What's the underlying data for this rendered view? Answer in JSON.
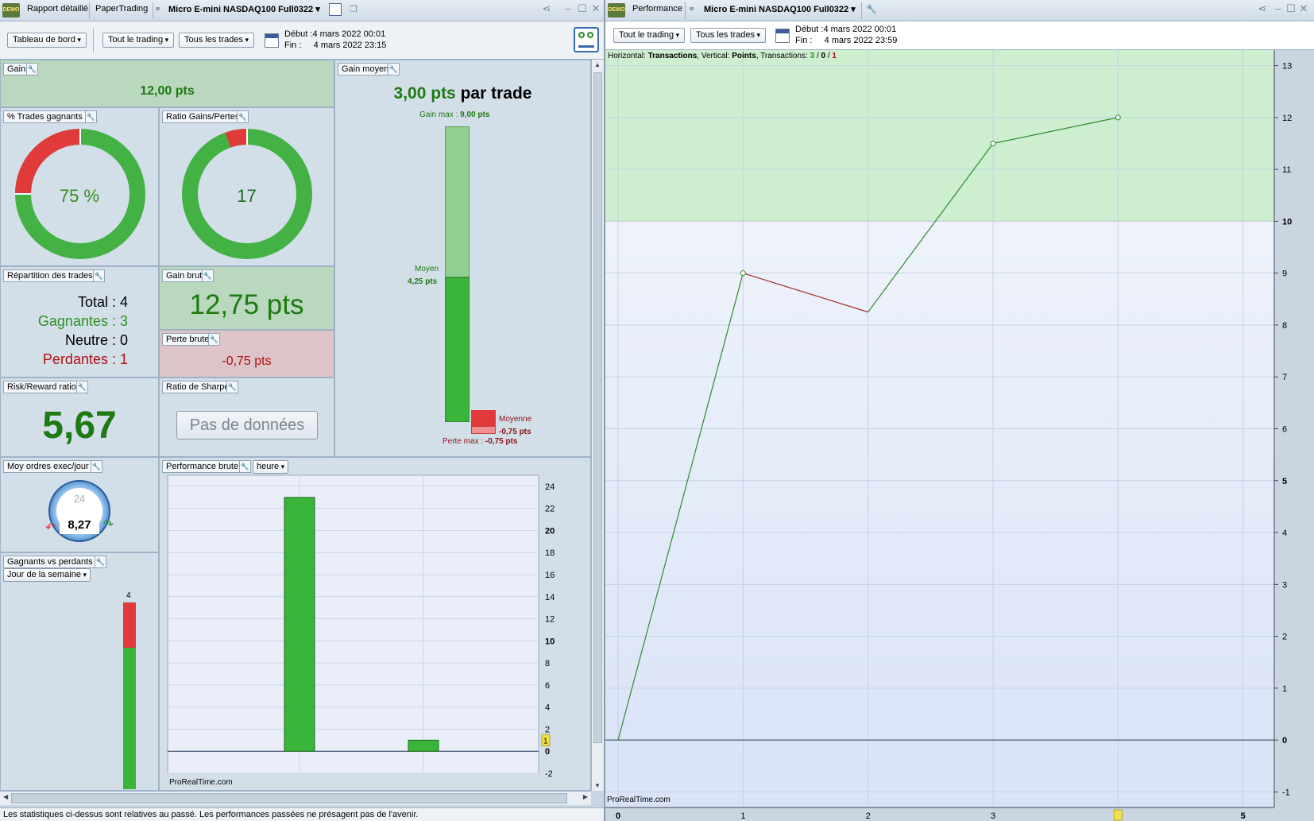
{
  "left_window": {
    "tabs": [
      "Rapport détaillé",
      "PaperTrading",
      "Micro E-mini NASDAQ100 Full0322"
    ],
    "demo_badge": "DEMO",
    "toolbar": {
      "dashboard": "Tableau de bord",
      "trading": "Tout le trading",
      "trades": "Tous les trades",
      "debut": "Début :4 mars 2022 00:01",
      "fin": "Fin :     4 mars 2022 23:15"
    }
  },
  "widgets": {
    "gain": {
      "title": "Gain",
      "value": "12,00 pts"
    },
    "pct_gagnants": {
      "title": "% Trades gagnants",
      "value": "75 %",
      "fraction": 0.75
    },
    "ratio_gp": {
      "title": "Ratio Gains/Pertes",
      "value": "17",
      "fraction": 0.944
    },
    "gain_moyen": {
      "title": "Gain moyen",
      "value": "3,00 pts",
      "suffix": "par trade",
      "gain_max_label": "Gain max :",
      "gain_max_value": "9,00 pts",
      "moyen_label": "Moyen",
      "moyen_value": "4,25 pts",
      "moyenne_label": "Moyenne",
      "moyenne_value": "-0,75 pts",
      "perte_max_label": "Perte max :",
      "perte_max_value": "-0,75 pts"
    },
    "repartition": {
      "title": "Répartition des trades",
      "total": "Total : 4",
      "gagnantes": "Gagnantes : 3",
      "neutre": "Neutre : 0",
      "perdantes": "Perdantes : 1"
    },
    "gain_brut": {
      "title": "Gain brut",
      "value": "12,75 pts"
    },
    "perte_brute": {
      "title": "Perte brute",
      "value": "-0,75 pts"
    },
    "risk_reward": {
      "title": "Risk/Reward ratio",
      "value": "5,67"
    },
    "sharpe": {
      "title": "Ratio de Sharpe",
      "value": "Pas de données"
    },
    "moy_ordres": {
      "title": "Moy ordres exec/jour",
      "value": "8,27",
      "dial_label": "24"
    },
    "gagnants_vs_perdants": {
      "title": "Gagnants vs perdants",
      "dropdown": "Jour de la semaine",
      "top_label": "4"
    },
    "perf_brute": {
      "title": "Performance brute",
      "dropdown": "heure",
      "watermark": "ProRealTime.com",
      "yticks": [
        "24",
        "22",
        "20",
        "18",
        "16",
        "14",
        "12",
        "10",
        "8",
        "6",
        "4",
        "2",
        "0",
        "-2"
      ],
      "marker": "1"
    }
  },
  "disclaimer": "Les statistiques ci-dessus sont relatives au passé. Les performances passées ne présagent pas de l'avenir.",
  "right_window": {
    "tabs": [
      "Performance",
      "Micro E-mini NASDAQ100 Full0322"
    ],
    "demo_badge": "DEMO",
    "toolbar": {
      "trading": "Tout le trading",
      "trades": "Tous les trades",
      "debut": "Début :4 mars 2022 00:01",
      "fin": "Fin :     4 mars 2022 23:59"
    },
    "info": {
      "h_label": "Horizontal:",
      "h_value": "Transactions",
      "v_label": "Vertical:",
      "v_value": "Points",
      "t_label": "Transactions:",
      "t_win": "3",
      "t_neutral": "0",
      "t_loss": "1"
    },
    "watermark": "ProRealTime.com"
  },
  "chart_data": [
    {
      "type": "line",
      "x": [
        0,
        1,
        2,
        3,
        4
      ],
      "y": [
        0,
        9,
        8.25,
        11.5,
        12
      ],
      "xticks": [
        "0",
        "1",
        "2",
        "3",
        "4",
        "5"
      ],
      "yticks": [
        "-1",
        "0",
        "1",
        "2",
        "3",
        "4",
        "5",
        "6",
        "7",
        "8",
        "9",
        "10",
        "11",
        "12",
        "13"
      ],
      "ylim": [
        -1.3,
        13.3
      ],
      "xlim": [
        0,
        5.25
      ],
      "threshold": 10,
      "colors": {
        "up": "#2e8b2e",
        "down": "#a52a2a"
      }
    },
    {
      "type": "bar",
      "categories": [
        "",
        ""
      ],
      "values": [
        23,
        1
      ],
      "ylim": [
        -2,
        25
      ]
    }
  ]
}
